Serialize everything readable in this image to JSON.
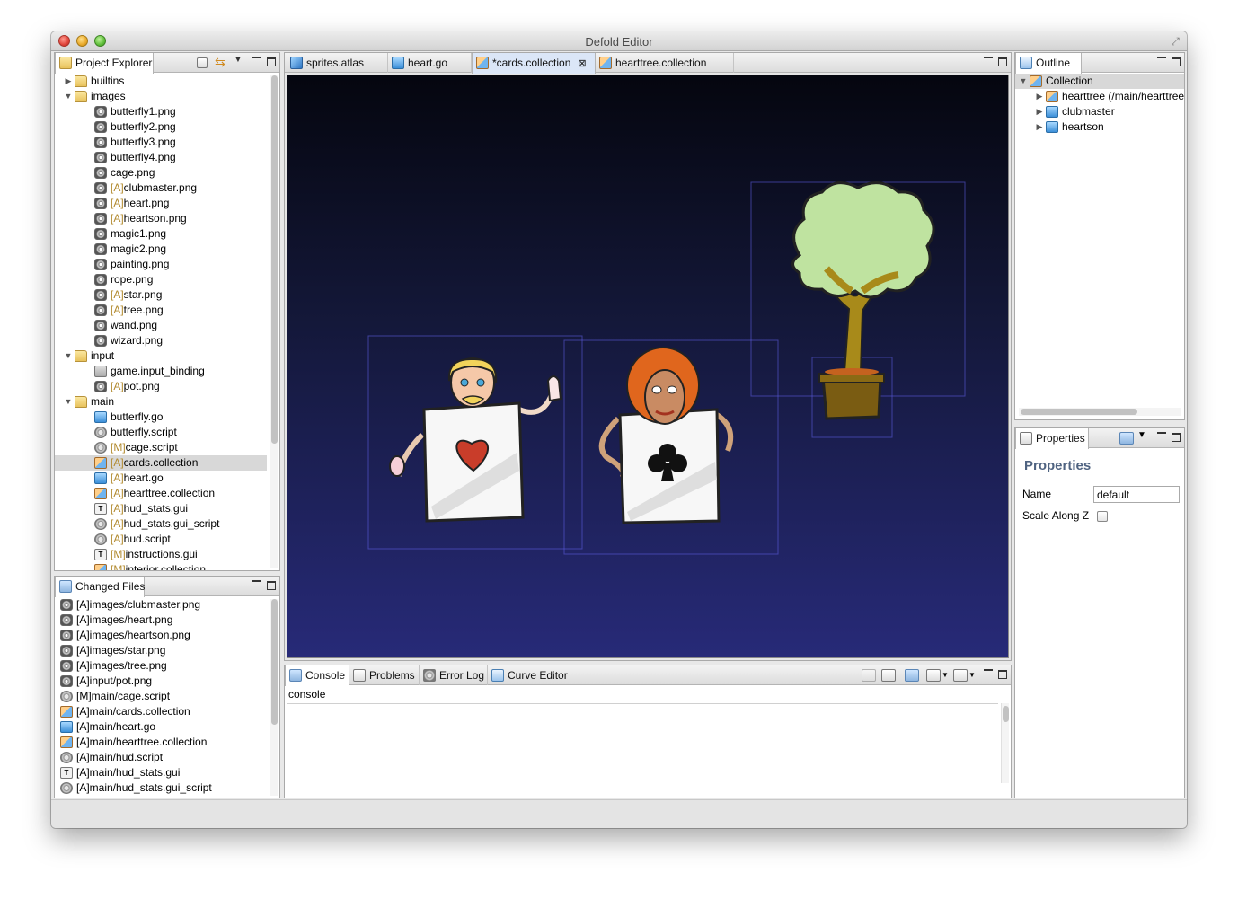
{
  "window": {
    "title": "Defold Editor"
  },
  "project_explorer": {
    "tab_label": "Project Explorer",
    "items": [
      {
        "label": "builtins",
        "prefix": "",
        "icon": "folder-icon",
        "indent": 0,
        "arrow": "▶"
      },
      {
        "label": "images",
        "prefix": "",
        "icon": "folder-open-icon",
        "indent": 0,
        "arrow": "▼"
      },
      {
        "label": "butterfly1.png",
        "prefix": "",
        "icon": "image-file-icon",
        "indent": 1,
        "arrow": ""
      },
      {
        "label": "butterfly2.png",
        "prefix": "",
        "icon": "image-file-icon",
        "indent": 1,
        "arrow": ""
      },
      {
        "label": "butterfly3.png",
        "prefix": "",
        "icon": "image-file-icon",
        "indent": 1,
        "arrow": ""
      },
      {
        "label": "butterfly4.png",
        "prefix": "",
        "icon": "image-file-icon",
        "indent": 1,
        "arrow": ""
      },
      {
        "label": "cage.png",
        "prefix": "",
        "icon": "image-file-icon",
        "indent": 1,
        "arrow": ""
      },
      {
        "label": "clubmaster.png",
        "prefix": "[A]",
        "icon": "image-file-icon",
        "indent": 1,
        "arrow": ""
      },
      {
        "label": "heart.png",
        "prefix": "[A]",
        "icon": "image-file-icon",
        "indent": 1,
        "arrow": ""
      },
      {
        "label": "heartson.png",
        "prefix": "[A]",
        "icon": "image-file-icon",
        "indent": 1,
        "arrow": ""
      },
      {
        "label": "magic1.png",
        "prefix": "",
        "icon": "image-file-icon",
        "indent": 1,
        "arrow": ""
      },
      {
        "label": "magic2.png",
        "prefix": "",
        "icon": "image-file-icon",
        "indent": 1,
        "arrow": ""
      },
      {
        "label": "painting.png",
        "prefix": "",
        "icon": "image-file-icon",
        "indent": 1,
        "arrow": ""
      },
      {
        "label": "rope.png",
        "prefix": "",
        "icon": "image-file-icon",
        "indent": 1,
        "arrow": ""
      },
      {
        "label": "star.png",
        "prefix": "[A]",
        "icon": "image-file-icon",
        "indent": 1,
        "arrow": ""
      },
      {
        "label": "tree.png",
        "prefix": "[A]",
        "icon": "image-file-icon",
        "indent": 1,
        "arrow": ""
      },
      {
        "label": "wand.png",
        "prefix": "",
        "icon": "image-file-icon",
        "indent": 1,
        "arrow": ""
      },
      {
        "label": "wizard.png",
        "prefix": "",
        "icon": "image-file-icon",
        "indent": 1,
        "arrow": ""
      },
      {
        "label": "input",
        "prefix": "",
        "icon": "folder-open-icon",
        "indent": 0,
        "arrow": "▼"
      },
      {
        "label": "game.input_binding",
        "prefix": "",
        "icon": "input-binding-icon",
        "indent": 1,
        "arrow": ""
      },
      {
        "label": "pot.png",
        "prefix": "[A]",
        "icon": "image-file-icon",
        "indent": 1,
        "arrow": ""
      },
      {
        "label": "main",
        "prefix": "",
        "icon": "folder-open-icon",
        "indent": 0,
        "arrow": "▼"
      },
      {
        "label": "butterfly.go",
        "prefix": "",
        "icon": "game-object-icon",
        "indent": 1,
        "arrow": ""
      },
      {
        "label": "butterfly.script",
        "prefix": "",
        "icon": "script-icon",
        "indent": 1,
        "arrow": ""
      },
      {
        "label": "cage.script",
        "prefix": "[M]",
        "icon": "script-icon",
        "indent": 1,
        "arrow": ""
      },
      {
        "label": "cards.collection",
        "prefix": "[A]",
        "icon": "collection-icon",
        "indent": 1,
        "arrow": "",
        "selected": true
      },
      {
        "label": "heart.go",
        "prefix": "[A]",
        "icon": "game-object-icon",
        "indent": 1,
        "arrow": ""
      },
      {
        "label": "hearttree.collection",
        "prefix": "[A]",
        "icon": "collection-icon",
        "indent": 1,
        "arrow": ""
      },
      {
        "label": "hud_stats.gui",
        "prefix": "[A]",
        "icon": "gui-icon",
        "indent": 1,
        "arrow": ""
      },
      {
        "label": "hud_stats.gui_script",
        "prefix": "[A]",
        "icon": "script-icon",
        "indent": 1,
        "arrow": ""
      },
      {
        "label": "hud.script",
        "prefix": "[A]",
        "icon": "script-icon",
        "indent": 1,
        "arrow": ""
      },
      {
        "label": "instructions.gui",
        "prefix": "[M]",
        "icon": "gui-icon",
        "indent": 1,
        "arrow": ""
      },
      {
        "label": "interior.collection",
        "prefix": "[M]",
        "icon": "collection-icon",
        "indent": 1,
        "arrow": ""
      }
    ]
  },
  "changed_files": {
    "tab_label": "Changed Files",
    "items": [
      {
        "label": "[A]images/clubmaster.png",
        "icon": "image-file-icon"
      },
      {
        "label": "[A]images/heart.png",
        "icon": "image-file-icon"
      },
      {
        "label": "[A]images/heartson.png",
        "icon": "image-file-icon"
      },
      {
        "label": "[A]images/star.png",
        "icon": "image-file-icon"
      },
      {
        "label": "[A]images/tree.png",
        "icon": "image-file-icon"
      },
      {
        "label": "[A]input/pot.png",
        "icon": "image-file-icon"
      },
      {
        "label": "[M]main/cage.script",
        "icon": "script-icon"
      },
      {
        "label": "[A]main/cards.collection",
        "icon": "collection-icon"
      },
      {
        "label": "[A]main/heart.go",
        "icon": "game-object-icon"
      },
      {
        "label": "[A]main/hearttree.collection",
        "icon": "collection-icon"
      },
      {
        "label": "[A]main/hud.script",
        "icon": "script-icon"
      },
      {
        "label": "[A]main/hud_stats.gui",
        "icon": "gui-icon"
      },
      {
        "label": "[A]main/hud_stats.gui_script",
        "icon": "script-icon"
      }
    ]
  },
  "editor_tabs": [
    {
      "label": "sprites.atlas",
      "icon": "atlas-icon",
      "active": false
    },
    {
      "label": "heart.go",
      "icon": "game-object-icon",
      "active": false
    },
    {
      "label": "*cards.collection",
      "icon": "collection-icon",
      "active": true
    },
    {
      "label": "hearttree.collection",
      "icon": "collection-icon",
      "active": false
    }
  ],
  "outline": {
    "tab_label": "Outline",
    "root": "Collection",
    "children": [
      {
        "label": "hearttree (/main/hearttree.collection)",
        "icon": "collection-icon"
      },
      {
        "label": "clubmaster",
        "icon": "game-object-icon"
      },
      {
        "label": "heartson",
        "icon": "game-object-icon"
      }
    ]
  },
  "properties": {
    "tab_label": "Properties",
    "heading": "Properties",
    "name_label": "Name",
    "name_value": "default",
    "scale_label": "Scale Along Z",
    "scale_checked": false
  },
  "bottom_tabs": [
    {
      "label": "Console",
      "icon": "console-icon",
      "active": true
    },
    {
      "label": "Problems",
      "icon": "problems-icon",
      "active": false
    },
    {
      "label": "Error Log",
      "icon": "error-log-icon",
      "active": false
    },
    {
      "label": "Curve Editor",
      "icon": "curve-editor-icon",
      "active": false
    }
  ],
  "console": {
    "label": "console"
  },
  "colors": {
    "viewport_top": "#05060f",
    "viewport_bottom": "#272a78",
    "selection": "#d8d8d8",
    "status_prefix": "#b28a2e",
    "properties_heading": "#4f6381"
  }
}
